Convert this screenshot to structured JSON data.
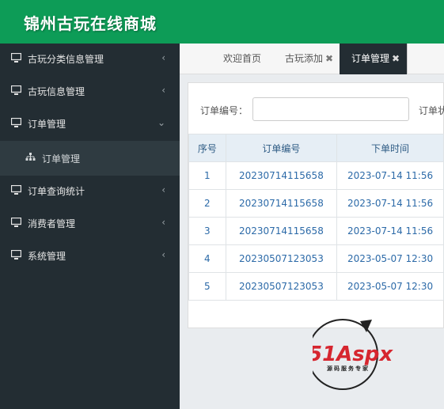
{
  "header": {
    "title": "锦州古玩在线商城"
  },
  "sidebar": {
    "items": [
      {
        "label": "古玩分类信息管理",
        "arrow": "‹"
      },
      {
        "label": "古玩信息管理",
        "arrow": "‹"
      },
      {
        "label": "订单管理",
        "arrow": "⌄"
      },
      {
        "label": "订单查询统计",
        "arrow": "‹"
      },
      {
        "label": "消费者管理",
        "arrow": "‹"
      },
      {
        "label": "系统管理",
        "arrow": "‹"
      }
    ],
    "sub_item": {
      "label": "订单管理"
    }
  },
  "tabs": [
    {
      "label": "欢迎首页"
    },
    {
      "label": "古玩添加",
      "close": "✖"
    },
    {
      "label": "订单管理",
      "close": "✖"
    }
  ],
  "search": {
    "order_no_label": "订单编号：",
    "second_label": "订单状"
  },
  "table": {
    "headers": [
      "序号",
      "订单编号",
      "下单时间"
    ],
    "rows": [
      [
        "1",
        "20230714115658",
        "2023-07-14 11:56"
      ],
      [
        "2",
        "20230714115658",
        "2023-07-14 11:56"
      ],
      [
        "3",
        "20230714115658",
        "2023-07-14 11:56"
      ],
      [
        "4",
        "20230507123053",
        "2023-05-07 12:30"
      ],
      [
        "5",
        "20230507123053",
        "2023-05-07 12:30"
      ]
    ]
  },
  "watermark": {
    "brand": "51Aspx",
    "slogan": "源码服务专家"
  },
  "colors": {
    "header_green": "#0d9c57",
    "sidebar_dark": "#232d33",
    "table_head": "#e6eef5",
    "link_blue": "#2c6aa8"
  }
}
